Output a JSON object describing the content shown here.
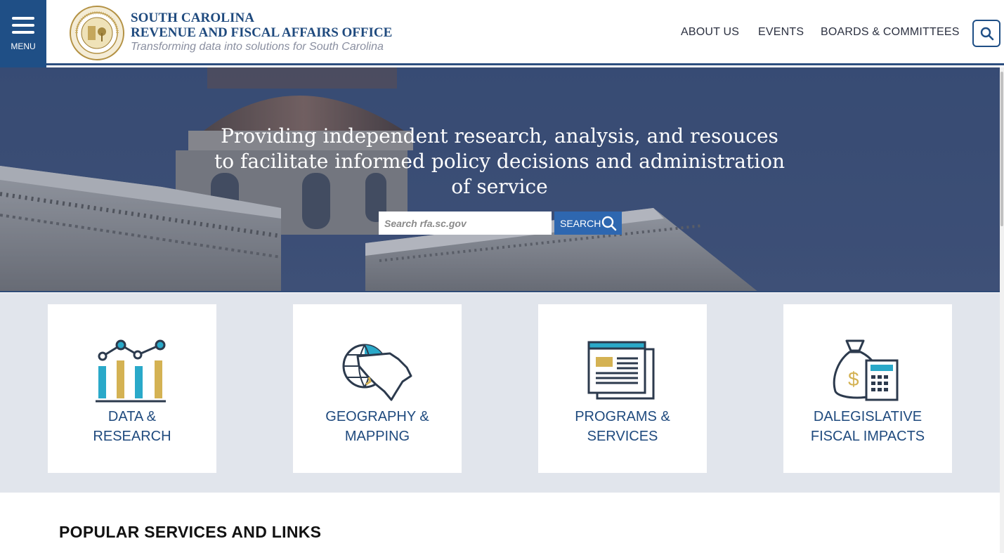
{
  "header": {
    "menu_label": "MENU",
    "brand_line1": "SOUTH CAROLINA",
    "brand_line2": "REVENUE AND FISCAL AFFAIRS OFFICE",
    "tagline": "Transforming data into solutions for South Carolina",
    "nav": [
      "ABOUT US",
      "EVENTS",
      "BOARDS & COMMITTEES"
    ],
    "seal_text_top": "REVENUE AND FISCAL AFFAIRS OFFICE",
    "seal_text_bottom": "SOUTH CAROLINA"
  },
  "hero": {
    "headline": "Providing independent research, analysis, and resouces to facilitate informed policy decisions and administration of service",
    "search_placeholder": "Search rfa.sc.gov",
    "search_button": "SEARCH"
  },
  "cards": [
    {
      "line1": "DATA &",
      "line2": "RESEARCH",
      "icon": "bar-chart-icon"
    },
    {
      "line1": "GEOGRAPHY &",
      "line2": "MAPPING",
      "icon": "globe-map-icon"
    },
    {
      "line1": "PROGRAMS &",
      "line2": "SERVICES",
      "icon": "document-icon"
    },
    {
      "line1": "DALEGISLATIVE",
      "line2": "FISCAL IMPACTS",
      "icon": "money-bag-calculator-icon"
    }
  ],
  "popular_heading": "POPULAR SERVICES AND LINKS",
  "colors": {
    "brand_blue": "#1f4a7e",
    "accent_teal": "#2aa9c9",
    "accent_gold": "#d4b253",
    "band_gray": "#e1e5ec"
  }
}
